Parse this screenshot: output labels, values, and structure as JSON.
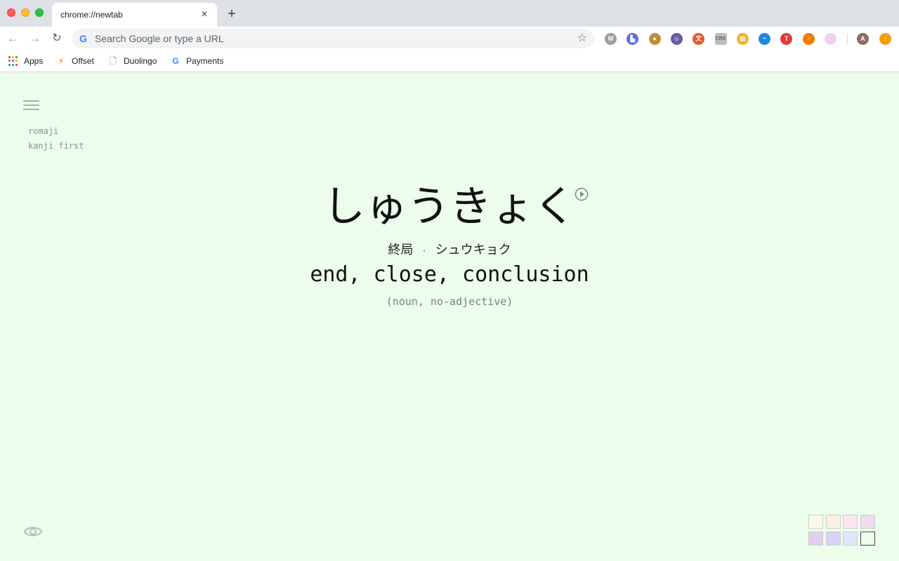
{
  "browser": {
    "tab_title": "chrome://newtab",
    "tab_close": "×",
    "new_tab": "+",
    "omnibox_placeholder": "Search Google or type a URL",
    "back": "←",
    "forward": "→",
    "reload": "↻",
    "star": "☆",
    "extensions": [
      {
        "icon": "m-extension-icon",
        "glyph": "M",
        "color": "#9e9e9e"
      },
      {
        "icon": "bars-extension-icon",
        "glyph": "▙",
        "color": "#5b6ee1"
      },
      {
        "icon": "cookie-extension-icon",
        "glyph": "●",
        "color": "#c58a3b"
      },
      {
        "icon": "face-extension-icon",
        "glyph": "☺",
        "color": "#6b5ca5"
      },
      {
        "icon": "translate-extension-icon",
        "glyph": "文",
        "color": "#e8572a"
      },
      {
        "icon": "crx-extension-icon",
        "glyph": "CRX",
        "color": "#bdbdbd"
      },
      {
        "icon": "grid-extension-icon",
        "glyph": "▦",
        "color": "#f2b233"
      },
      {
        "icon": "pulse-extension-icon",
        "glyph": "~",
        "color": "#1e88e5"
      },
      {
        "icon": "rainbow-extension-icon",
        "glyph": "T",
        "color": "#e53935"
      },
      {
        "icon": "clock-extension-icon",
        "glyph": "◔",
        "color": "#f57c00"
      },
      {
        "icon": "pink-dot-extension-icon",
        "glyph": "",
        "color": "#f1d1f3"
      }
    ],
    "avatar_letter": "A",
    "update_glyph": "↑"
  },
  "bookmarks": [
    {
      "label": "Apps",
      "icon": "apps-grid-icon"
    },
    {
      "label": "Offset",
      "icon": "offset-icon",
      "glyph": "⚡"
    },
    {
      "label": "Duolingo",
      "icon": "page-icon",
      "glyph": "🗋"
    },
    {
      "label": "Payments",
      "icon": "google-g-icon",
      "glyph": "G"
    }
  ],
  "options": {
    "romaji": "romaji",
    "kanji_first": "kanji first"
  },
  "word": {
    "kana": "しゅうきょく",
    "kanji": "終局",
    "separator": "·",
    "katakana": "シュウキョク",
    "meaning": "end, close, conclusion",
    "part_of_speech": "(noun, no-adjective)"
  },
  "theme_swatches": [
    "#fdf9e6",
    "#fcefe6",
    "#fbe6ef",
    "#efdcef",
    "#e1cff0",
    "#d8d2f8",
    "#dfe7fb",
    "#ecfdec"
  ],
  "colors": {
    "page_background": "#ecfdec",
    "selected_swatch_border": "#3f4a3f"
  }
}
